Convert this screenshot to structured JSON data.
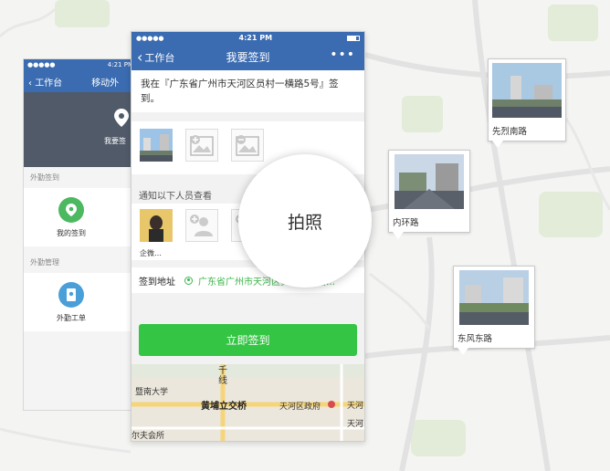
{
  "background_map": {
    "road_labels": [
      "先烈南路",
      "内环路",
      "东风东路"
    ]
  },
  "back_phone": {
    "status_left": "●●●●● ",
    "status_time": "4:21 PM",
    "nav_back": "工作台",
    "nav_title": "移动外",
    "hero_label": "我要签",
    "section1": "外勤签到",
    "item1_label": "我的签到",
    "section2": "外勤管理",
    "item2_label": "外勤工单"
  },
  "phone": {
    "status_left": "●●●●●",
    "status_time": "4:21 PM",
    "nav_back": "工作台",
    "nav_title": "我要签到",
    "nav_more": "•••",
    "message": "我在『广东省广州市天河区员村一横路5号』签到。",
    "notify_label": "通知以下人员查看",
    "person_name": "企微…",
    "address_label": "签到地址",
    "address_value": "广东省广州市天河区员村一横路…",
    "submit_label": "立即签到",
    "map_labels": [
      "千线",
      "暨南大学",
      "黄埔立交桥",
      "天河区政府",
      "天河",
      "尔夫会所",
      "天河"
    ]
  },
  "magnifier": {
    "label": "拍照"
  },
  "colors": {
    "nav_blue": "#3b6bb0",
    "green": "#35c545",
    "address_green": "#3bb44a"
  }
}
